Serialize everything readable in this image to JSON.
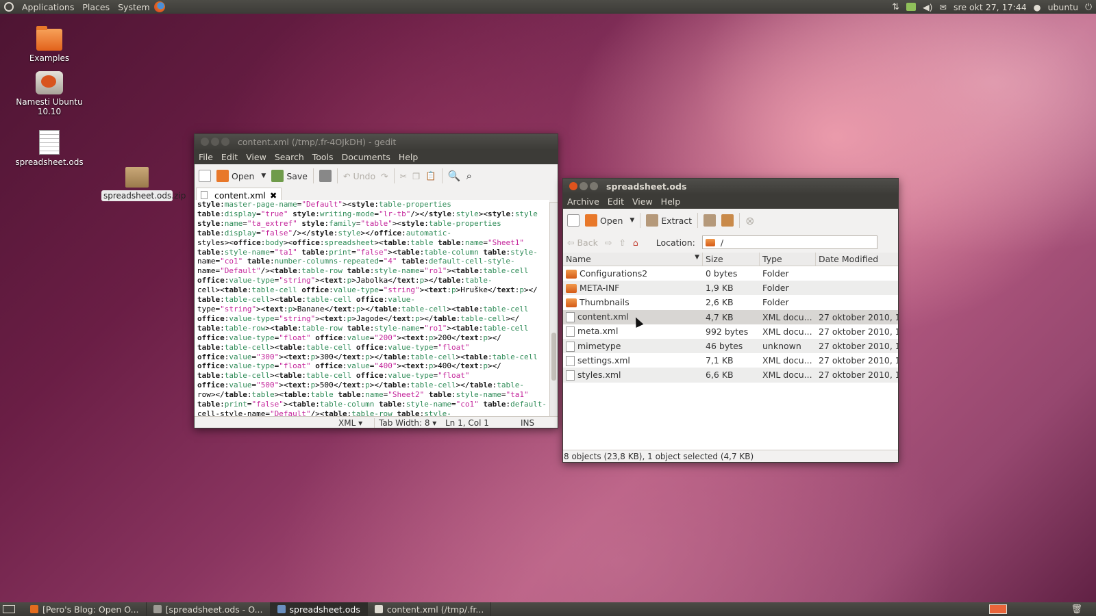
{
  "topbar": {
    "menus": [
      "Applications",
      "Places",
      "System"
    ],
    "clock": "sre okt 27, 17:44",
    "user": "ubuntu"
  },
  "desktop": {
    "icons": [
      "Examples",
      "Namesti Ubuntu 10.10",
      "spreadsheet.ods",
      "spreadsheet.ods.zip"
    ]
  },
  "gedit": {
    "title": "content.xml (/tmp/.fr-4OJkDH) - gedit",
    "menu": [
      "File",
      "Edit",
      "View",
      "Search",
      "Tools",
      "Documents",
      "Help"
    ],
    "toolbar": {
      "open": "Open",
      "save": "Save",
      "undo": "Undo"
    },
    "tab": "content.xml",
    "lines": [
      "style:master-page-name=\"Default\"><style:table-properties",
      "table:display=\"true\" style:writing-mode=\"lr-tb\"/></style:style><style:style",
      "style:name=\"ta_extref\" style:family=\"table\"><style:table-properties",
      "table:display=\"false\"/></style:style></office:automatic-",
      "styles><office:body><office:spreadsheet><table:table table:name=\"Sheet1\"",
      "table:style-name=\"ta1\" table:print=\"false\"><table:table-column table:style-",
      "name=\"co1\" table:number-columns-repeated=\"4\" table:default-cell-style-",
      "name=\"Default\"/><table:table-row table:style-name=\"ro1\"><table:table-cell",
      "office:value-type=\"string\"><text:p>Jabolka</text:p></table:table-",
      "cell><table:table-cell office:value-type=\"string\"><text:p>Hruške</text:p></",
      "table:table-cell><table:table-cell office:value-",
      "type=\"string\"><text:p>Banane</text:p></table:table-cell><table:table-cell",
      "office:value-type=\"string\"><text:p>Jagode</text:p></table:table-cell></",
      "table:table-row><table:table-row table:style-name=\"ro1\"><table:table-cell",
      "office:value-type=\"float\" office:value=\"200\"><text:p>200</text:p></",
      "table:table-cell><table:table-cell office:value-type=\"float\"",
      "office:value=\"300\"><text:p>300</text:p></table:table-cell><table:table-cell",
      "office:value-type=\"float\" office:value=\"400\"><text:p>400</text:p></",
      "table:table-cell><table:table-cell office:value-type=\"float\"",
      "office:value=\"500\"><text:p>500</text:p></table:table-cell></table:table-",
      "row></table:table><table:table table:name=\"Sheet2\" table:style-name=\"ta1\"",
      "table:print=\"false\"><table:table-column table:style-name=\"co1\" table:default-",
      "cell-style-name=\"Default\"/><table:table-row table:style-"
    ],
    "status": {
      "lang": "XML",
      "tab_width": "Tab Width: 8",
      "position": "Ln 1, Col 1",
      "mode": "INS"
    }
  },
  "archive": {
    "title": "spreadsheet.ods",
    "menu": [
      "Archive",
      "Edit",
      "View",
      "Help"
    ],
    "toolbar": {
      "open": "Open",
      "extract": "Extract",
      "back": "Back",
      "location_label": "Location:",
      "location_value": "/"
    },
    "columns": [
      "Name",
      "Size",
      "Type",
      "Date Modified"
    ],
    "rows": [
      {
        "name": "Configurations2",
        "size": "0 bytes",
        "type": "Folder",
        "date": "",
        "kind": "folder"
      },
      {
        "name": "META-INF",
        "size": "1,9 KB",
        "type": "Folder",
        "date": "",
        "kind": "folder"
      },
      {
        "name": "Thumbnails",
        "size": "2,6 KB",
        "type": "Folder",
        "date": "",
        "kind": "folder"
      },
      {
        "name": "content.xml",
        "size": "4,7 KB",
        "type": "XML docu...",
        "date": "27 oktober 2010, 1...",
        "kind": "doc"
      },
      {
        "name": "meta.xml",
        "size": "992 bytes",
        "type": "XML docu...",
        "date": "27 oktober 2010, 1...",
        "kind": "doc"
      },
      {
        "name": "mimetype",
        "size": "46 bytes",
        "type": "unknown",
        "date": "27 oktober 2010, 1...",
        "kind": "doc"
      },
      {
        "name": "settings.xml",
        "size": "7,1 KB",
        "type": "XML docu...",
        "date": "27 oktober 2010, 1...",
        "kind": "doc"
      },
      {
        "name": "styles.xml",
        "size": "6,6 KB",
        "type": "XML docu...",
        "date": "27 oktober 2010, 1...",
        "kind": "doc"
      }
    ],
    "status": "8 objects (23,8 KB), 1 object selected (4,7 KB)"
  },
  "taskbar": {
    "tasks": [
      "[Pero's Blog: Open O...",
      "[spreadsheet.ods - O...",
      "spreadsheet.ods",
      "content.xml (/tmp/.fr..."
    ]
  }
}
